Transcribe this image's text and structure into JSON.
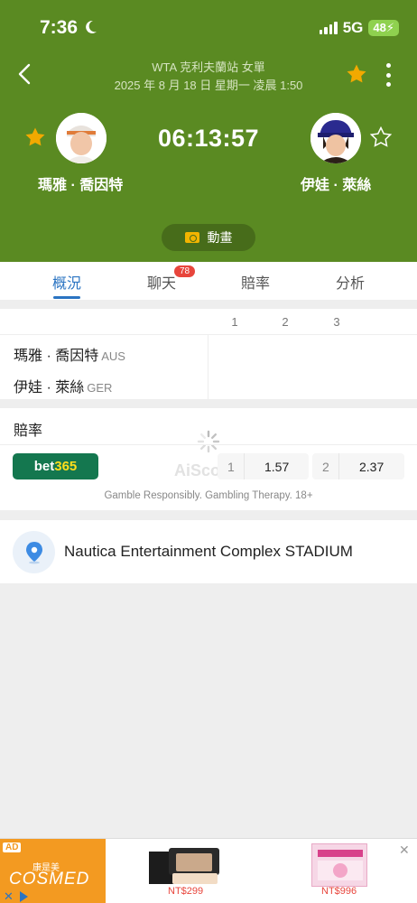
{
  "status_bar": {
    "time": "7:36",
    "network": "5G",
    "battery": "48"
  },
  "header": {
    "title": "WTA 克利夫蘭站 女單",
    "date": "2025 年 8 月 18 日 星期一 凌晨 1:50",
    "timer": "06:13:57",
    "player1": {
      "name": "瑪雅 · 喬因特",
      "favorited": true
    },
    "player2": {
      "name": "伊娃 · 萊絲",
      "favorited": false
    },
    "animation_label": "動畫",
    "colors": {
      "background": "#5a8a22",
      "star": "#f2a900"
    }
  },
  "tabs": [
    {
      "label": "概況",
      "active": true
    },
    {
      "label": "聊天",
      "badge": "78"
    },
    {
      "label": "賠率"
    },
    {
      "label": "分析"
    }
  ],
  "scoreboard": {
    "sets": [
      "1",
      "2",
      "3"
    ],
    "players": [
      {
        "name": "瑪雅 · 喬因特",
        "country": "AUS"
      },
      {
        "name": "伊娃 · 萊絲",
        "country": "GER"
      }
    ]
  },
  "odds": {
    "title": "賠率",
    "bookmaker": {
      "name_a": "bet",
      "name_b": "365"
    },
    "watermark": "AiScore",
    "home": {
      "label": "1",
      "value": "1.57"
    },
    "away": {
      "label": "2",
      "value": "2.37"
    },
    "disclaimer": "Gamble Responsibly. Gambling Therapy. 18+"
  },
  "venue": {
    "name": "Nautica Entertainment Complex STADIUM",
    "icon": "location-pin-icon"
  },
  "ad": {
    "tag": "AD",
    "brand_cn": "康是美",
    "brand": "COSMED",
    "price1": "NT$299",
    "price2": "NT$996"
  }
}
